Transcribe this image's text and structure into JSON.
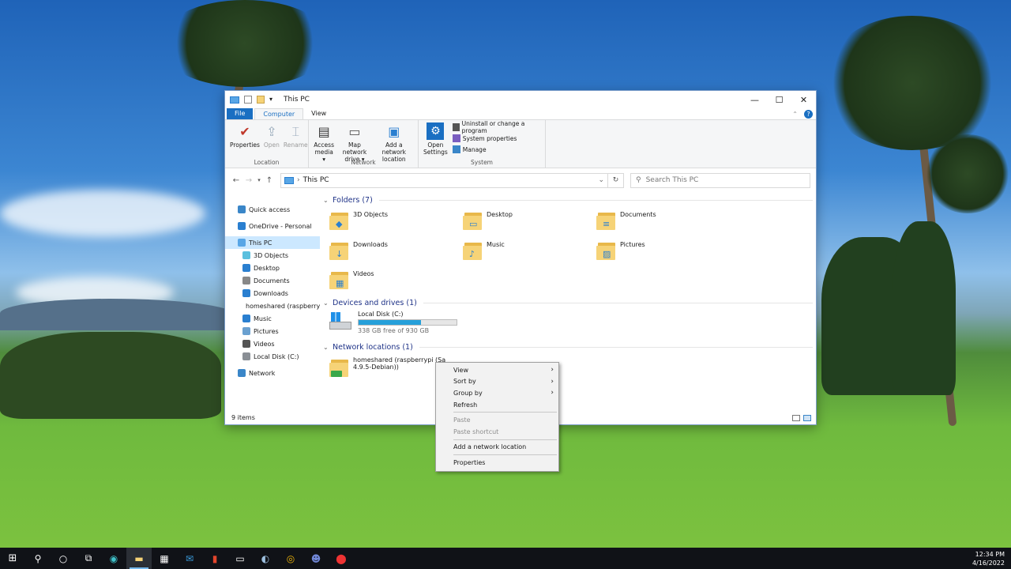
{
  "window": {
    "title": "This PC",
    "controls": {
      "minimize": "—",
      "maximize": "☐",
      "close": "✕"
    }
  },
  "ribbon": {
    "tabs": [
      "File",
      "Computer",
      "View"
    ],
    "location_group": {
      "label": "Location",
      "buttons": [
        "Properties",
        "Open",
        "Rename"
      ]
    },
    "network_group": {
      "label": "Network",
      "access_media": [
        "Access",
        "media ▾"
      ],
      "map_network_drive": [
        "Map network",
        "drive ▾"
      ],
      "add_network_location": [
        "Add a network",
        "location"
      ]
    },
    "system_group": {
      "label": "System",
      "open_settings": [
        "Open",
        "Settings"
      ],
      "uninstall": "Uninstall or change a program",
      "system_properties": "System properties",
      "manage": "Manage"
    }
  },
  "address": {
    "path": "This PC",
    "search_placeholder": "Search This PC"
  },
  "nav": {
    "items": [
      {
        "label": "Quick access",
        "icon": "star-icon",
        "indent": 0
      },
      {
        "label": "OneDrive - Personal",
        "icon": "cloud-icon",
        "indent": 0
      },
      {
        "label": "This PC",
        "icon": "computer-icon",
        "indent": 0,
        "selected": true
      },
      {
        "label": "3D Objects",
        "icon": "cube-icon",
        "indent": 1
      },
      {
        "label": "Desktop",
        "icon": "desktop-icon",
        "indent": 1
      },
      {
        "label": "Documents",
        "icon": "document-icon",
        "indent": 1
      },
      {
        "label": "Downloads",
        "icon": "download-icon",
        "indent": 1
      },
      {
        "label": "homeshared (raspberry",
        "icon": "network-folder-icon",
        "indent": 1
      },
      {
        "label": "Music",
        "icon": "music-icon",
        "indent": 1
      },
      {
        "label": "Pictures",
        "icon": "pictures-icon",
        "indent": 1
      },
      {
        "label": "Videos",
        "icon": "video-icon",
        "indent": 1
      },
      {
        "label": "Local Disk (C:)",
        "icon": "drive-icon",
        "indent": 1
      },
      {
        "label": "Network",
        "icon": "network-icon",
        "indent": 0
      }
    ]
  },
  "sections": {
    "folders": {
      "header": "Folders (7)",
      "items": [
        {
          "label": "3D Objects",
          "badge": "◆"
        },
        {
          "label": "Desktop",
          "badge": "▭"
        },
        {
          "label": "Documents",
          "badge": "≡"
        },
        {
          "label": "Downloads",
          "badge": "↓"
        },
        {
          "label": "Music",
          "badge": "♪"
        },
        {
          "label": "Pictures",
          "badge": "▨"
        },
        {
          "label": "Videos",
          "badge": "▦"
        }
      ]
    },
    "devices": {
      "header": "Devices and drives (1)",
      "drive_label": "Local Disk (C:)",
      "drive_free": "338 GB free of 930 GB",
      "used_fraction": 0.637
    },
    "network": {
      "header": "Network locations (1)",
      "item_line1": "homeshared (raspberrypi (Sa",
      "item_line2": "4.9.5-Debian))"
    }
  },
  "status": {
    "item_count": "9 items"
  },
  "context_menu": {
    "view": "View",
    "sort_by": "Sort by",
    "group_by": "Group by",
    "refresh": "Refresh",
    "paste": "Paste",
    "paste_shortcut": "Paste shortcut",
    "add_network_location": "Add a network location",
    "properties": "Properties"
  },
  "taskbar": {
    "time": "12:34 PM",
    "date": "4/16/2022"
  },
  "colors": {
    "accent": "#1a6fc2",
    "selection": "#cce8ff",
    "drive_bar": "#26a0da",
    "section_header": "#1e3287"
  }
}
